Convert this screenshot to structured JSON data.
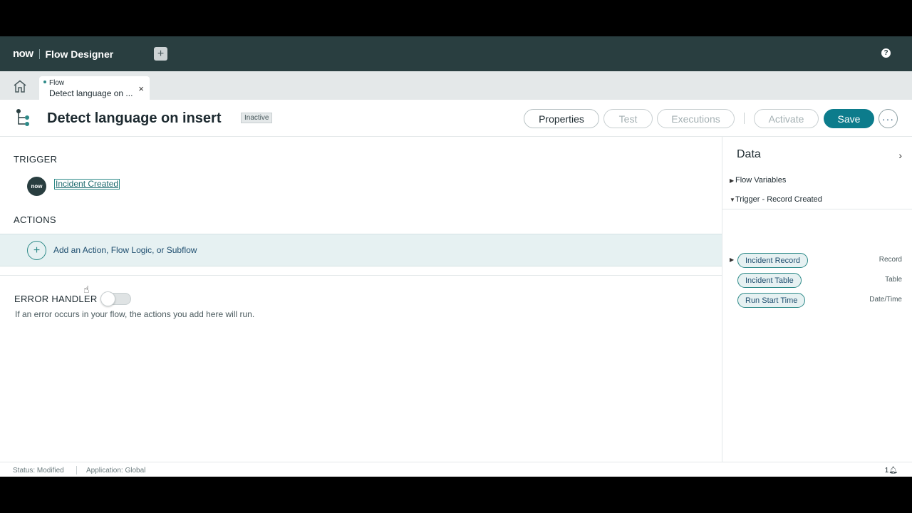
{
  "header": {
    "brand": "now",
    "title": "Flow Designer",
    "help": "?"
  },
  "tabs": {
    "active": {
      "type": "Flow",
      "name": "Detect language on ...",
      "close": "×"
    },
    "add": "+"
  },
  "titlebar": {
    "title": "Detect language on insert",
    "status": "Inactive",
    "properties": "Properties",
    "test": "Test",
    "executions": "Executions",
    "activate": "Activate",
    "save": "Save",
    "more": "···"
  },
  "main": {
    "trigger_label": "TRIGGER",
    "trigger_avatar": "now",
    "trigger_name": "Incident Created",
    "actions_label": "ACTIONS",
    "add_action": "Add an Action, Flow Logic, or Subflow",
    "error_label": "ERROR HANDLER",
    "error_desc": "If an error occurs in your flow, the actions you add here will run."
  },
  "data_panel": {
    "title": "Data",
    "sections": [
      "Flow Variables",
      "Trigger - Record Created"
    ],
    "pills": [
      {
        "label": "Incident Record",
        "type": "Record"
      },
      {
        "label": "Incident Table",
        "type": "Table"
      },
      {
        "label": "Run Start Time",
        "type": "Date/Time"
      }
    ]
  },
  "status": {
    "status": "Status: Modified",
    "application": "Application: Global",
    "notifications": "1"
  },
  "colors": {
    "header": "#293e40",
    "accent": "#0c7c8c",
    "teal": "#2d8a88"
  }
}
